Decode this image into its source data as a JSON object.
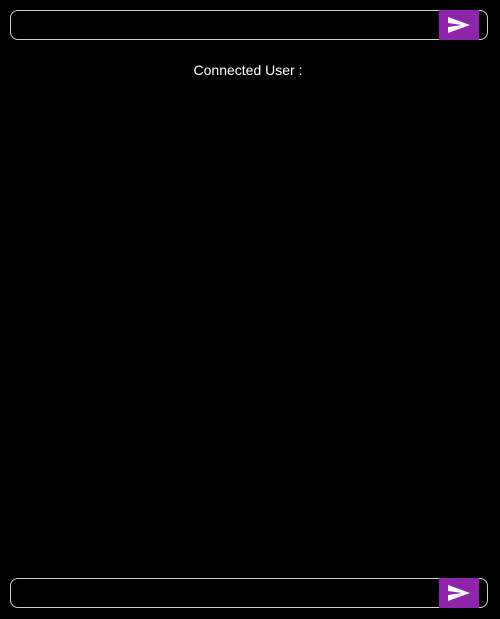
{
  "top_bar": {
    "input_value": "",
    "input_placeholder": "",
    "send_icon": "send-icon"
  },
  "status": {
    "connected_label": "Connected User :"
  },
  "bottom_bar": {
    "input_value": "",
    "input_placeholder": "",
    "send_icon": "send-icon"
  },
  "colors": {
    "background": "#000000",
    "accent": "#8e24aa",
    "border": "#cfcfcf",
    "text": "#ffffff"
  }
}
